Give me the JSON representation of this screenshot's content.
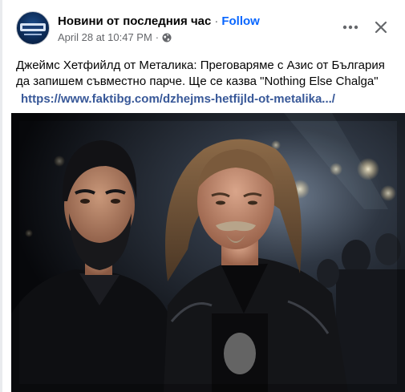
{
  "post": {
    "page_name": "Новини от последния час",
    "separator": "·",
    "follow_label": "Follow",
    "date": "April 28 at 10:47 PM",
    "meta_separator": "·",
    "audience_icon": "globe-icon",
    "more_icon": "more-options-icon",
    "close_icon": "close-icon",
    "text": "Джеймс Хетфийлд от Металика: Преговаряме с Азис от България да запишем съвместно парче. Ще се казва \"Nothing Else Chalga\"",
    "link": "https://www.faktibg.com/dzhejms-hetfijld-ot-metalika.../"
  },
  "colors": {
    "follow": "#0866ff",
    "link": "#385898",
    "meta": "#65676b"
  }
}
